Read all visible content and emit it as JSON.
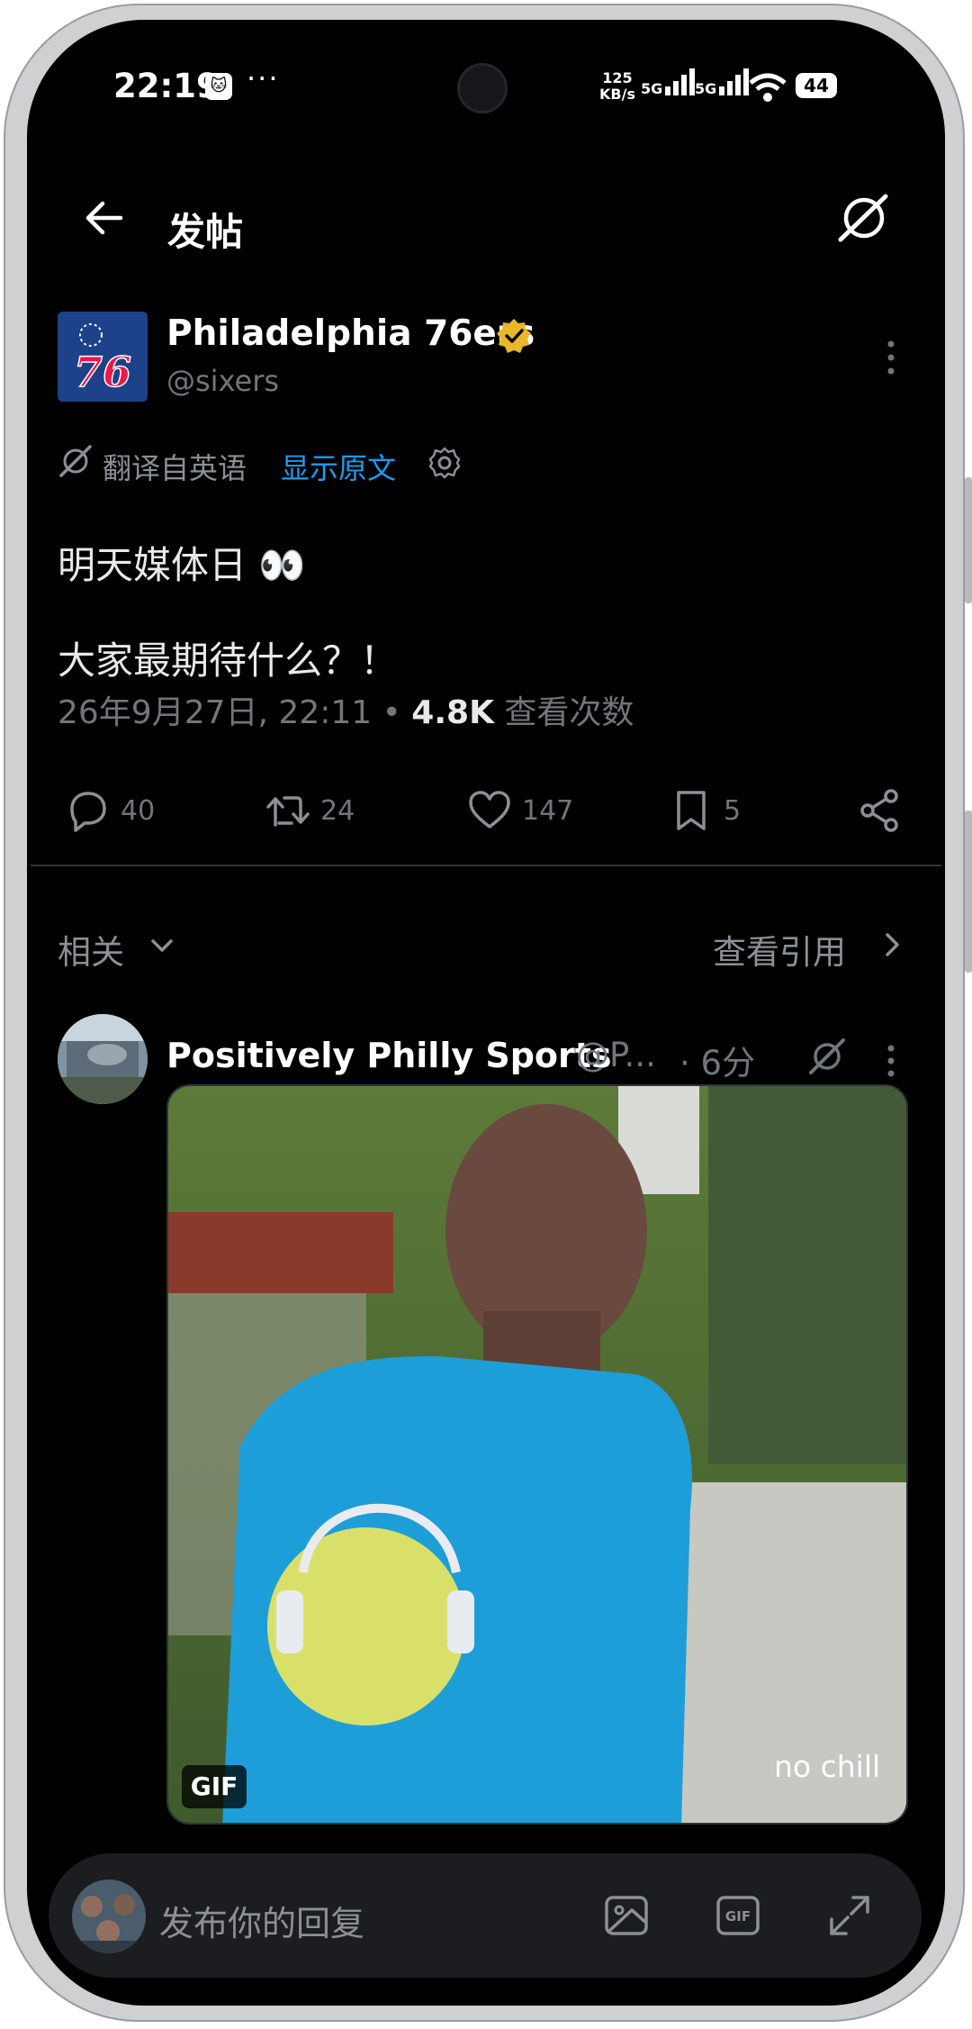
{
  "status_bar": {
    "time": "22:19",
    "app_icon": "cat-app-icon",
    "more": "···",
    "speed_value": "125",
    "speed_unit": "KB/s",
    "net1": "5G",
    "net2": "5G",
    "battery": "44"
  },
  "header": {
    "title": "发帖",
    "back_icon": "arrow-left-icon",
    "grok_icon": "grok-icon"
  },
  "post": {
    "author_name": "Philadelphia 76ers",
    "handle": "@sixers",
    "avatar_text": "76",
    "translated_label": "翻译自英语",
    "show_original": "显示原文",
    "line1": "明天媒体日 👀",
    "line2": "大家最期待什么？！",
    "timestamp": "26年9月27日, 22:11",
    "separator": "•",
    "views_count": "4.8K",
    "views_label": "查看次数",
    "replies": "40",
    "reposts": "24",
    "likes": "147",
    "bookmarks": "5"
  },
  "related": {
    "label": "相关",
    "view_quotes": "查看引用"
  },
  "reply_post": {
    "author_name": "Positively Philly Sports",
    "handle": "@P...",
    "time": "· 6分",
    "gif_badge": "GIF",
    "caption": "no chill"
  },
  "reply_bar": {
    "placeholder": "发布你的回复"
  },
  "colors": {
    "background": "#000000",
    "link": "#1d9bf0",
    "muted": "#71767b",
    "verified_gold": "#e8b829",
    "sixers_blue": "#1d428a",
    "sixers_red": "#ed174c"
  }
}
